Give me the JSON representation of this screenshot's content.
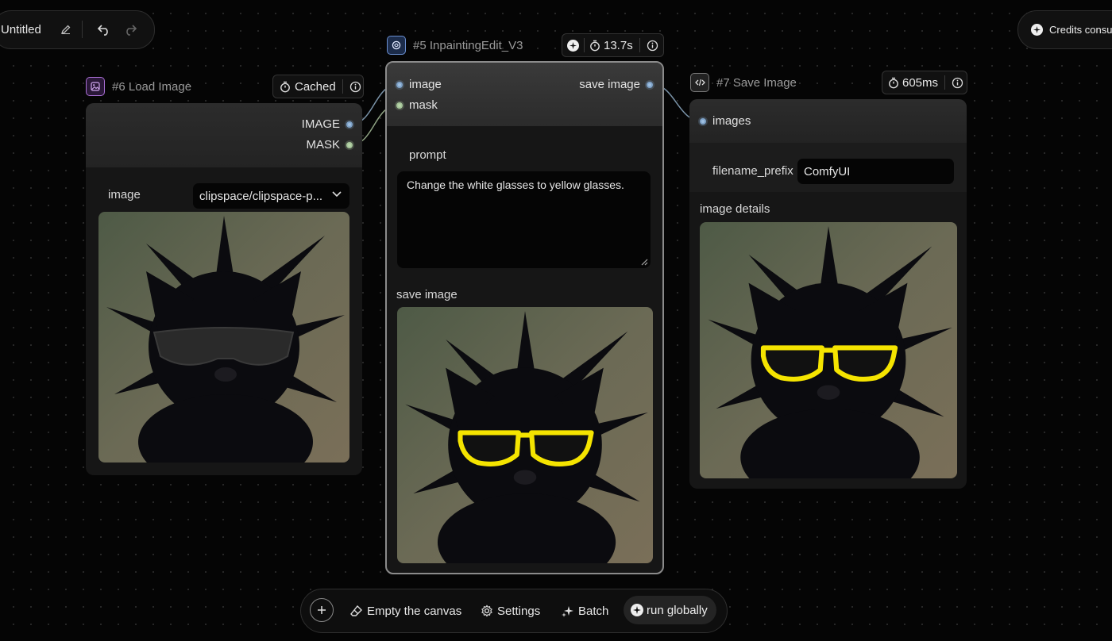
{
  "workflow": {
    "title": "Untitled",
    "credits_label": "Credits consumed"
  },
  "nodes": {
    "load_image": {
      "title": "#6 Load Image",
      "status": "Cached",
      "outputs": [
        "IMAGE",
        "MASK"
      ],
      "image_label": "image",
      "image_value": "clipspace/clipspace-p..."
    },
    "inpainting": {
      "title": "#5 InpaintingEdit_V3",
      "duration": "13.7s",
      "inputs": [
        "image",
        "mask"
      ],
      "output": "save image",
      "prompt_label": "prompt",
      "prompt_value": "Change the white glasses to yellow glasses.",
      "preview_label": "save image"
    },
    "save_image": {
      "title": "#7 Save Image",
      "duration": "605ms",
      "input": "images",
      "filename_prefix_label": "filename_prefix",
      "filename_prefix_value": "ComfyUI",
      "details_label": "image details"
    }
  },
  "toolbar": {
    "empty_label": "Empty the canvas",
    "settings_label": "Settings",
    "batch_label": "Batch",
    "run_label": "run globally"
  },
  "colors": {
    "canvas": "#050505",
    "node_body": "#161616",
    "link": "#7a93a8",
    "glasses": "#f5e400"
  }
}
